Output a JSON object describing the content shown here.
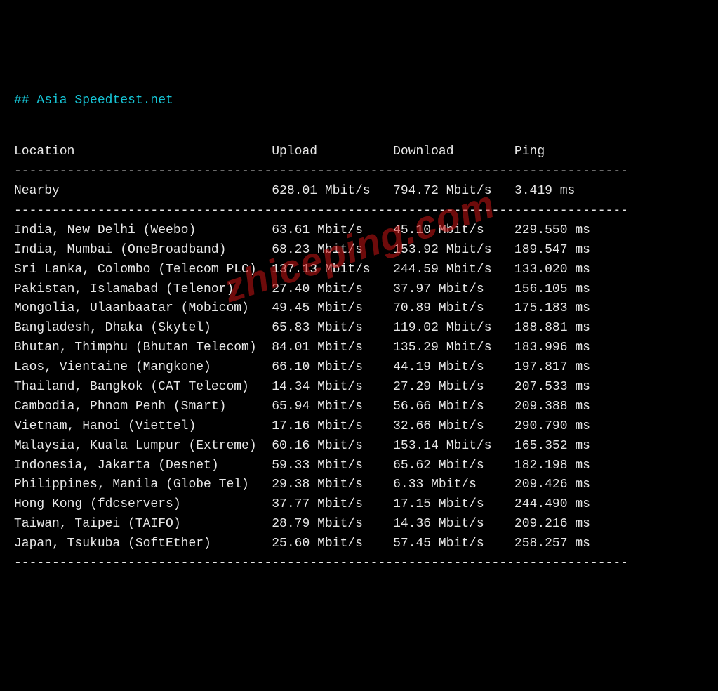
{
  "title": "## Asia Speedtest.net",
  "columns": {
    "location": "Location",
    "upload": "Upload",
    "download": "Download",
    "ping": "Ping"
  },
  "separator": "---------------------------------------------------------------------------------",
  "nearby": {
    "location": "Nearby",
    "upload": "628.01 Mbit/s",
    "download": "794.72 Mbit/s",
    "ping": "3.419 ms"
  },
  "rows": [
    {
      "location": "India, New Delhi (Weebo)",
      "upload": "63.61 Mbit/s",
      "download": "45.10 Mbit/s",
      "ping": "229.550 ms"
    },
    {
      "location": "India, Mumbai (OneBroadband)",
      "upload": "68.23 Mbit/s",
      "download": "153.92 Mbit/s",
      "ping": "189.547 ms"
    },
    {
      "location": "Sri Lanka, Colombo (Telecom PLC)",
      "upload": "137.13 Mbit/s",
      "download": "244.59 Mbit/s",
      "ping": "133.020 ms"
    },
    {
      "location": "Pakistan, Islamabad (Telenor)",
      "upload": "27.40 Mbit/s",
      "download": "37.97 Mbit/s",
      "ping": "156.105 ms"
    },
    {
      "location": "Mongolia, Ulaanbaatar (Mobicom)",
      "upload": "49.45 Mbit/s",
      "download": "70.89 Mbit/s",
      "ping": "175.183 ms"
    },
    {
      "location": "Bangladesh, Dhaka (Skytel)",
      "upload": "65.83 Mbit/s",
      "download": "119.02 Mbit/s",
      "ping": "188.881 ms"
    },
    {
      "location": "Bhutan, Thimphu (Bhutan Telecom)",
      "upload": "84.01 Mbit/s",
      "download": "135.29 Mbit/s",
      "ping": "183.996 ms"
    },
    {
      "location": "Laos, Vientaine (Mangkone)",
      "upload": "66.10 Mbit/s",
      "download": "44.19 Mbit/s",
      "ping": "197.817 ms"
    },
    {
      "location": "Thailand, Bangkok (CAT Telecom)",
      "upload": "14.34 Mbit/s",
      "download": "27.29 Mbit/s",
      "ping": "207.533 ms"
    },
    {
      "location": "Cambodia, Phnom Penh (Smart)",
      "upload": "65.94 Mbit/s",
      "download": "56.66 Mbit/s",
      "ping": "209.388 ms"
    },
    {
      "location": "Vietnam, Hanoi (Viettel)",
      "upload": "17.16 Mbit/s",
      "download": "32.66 Mbit/s",
      "ping": "290.790 ms"
    },
    {
      "location": "Malaysia, Kuala Lumpur (Extreme)",
      "upload": "60.16 Mbit/s",
      "download": "153.14 Mbit/s",
      "ping": "165.352 ms"
    },
    {
      "location": "Indonesia, Jakarta (Desnet)",
      "upload": "59.33 Mbit/s",
      "download": "65.62 Mbit/s",
      "ping": "182.198 ms"
    },
    {
      "location": "Philippines, Manila (Globe Tel)",
      "upload": "29.38 Mbit/s",
      "download": "6.33 Mbit/s",
      "ping": "209.426 ms"
    },
    {
      "location": "Hong Kong (fdcservers)",
      "upload": "37.77 Mbit/s",
      "download": "17.15 Mbit/s",
      "ping": "244.490 ms"
    },
    {
      "location": "Taiwan, Taipei (TAIFO)",
      "upload": "28.79 Mbit/s",
      "download": "14.36 Mbit/s",
      "ping": "209.216 ms"
    },
    {
      "location": "Japan, Tsukuba (SoftEther)",
      "upload": "25.60 Mbit/s",
      "download": "57.45 Mbit/s",
      "ping": "258.257 ms"
    }
  ],
  "watermark": "zhiceping.com"
}
